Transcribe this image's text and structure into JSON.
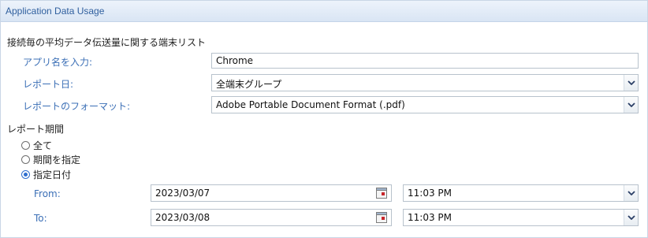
{
  "panel": {
    "title": "Application Data Usage"
  },
  "report": {
    "title": "接続毎の平均データ伝送量に関する端末リスト",
    "app_name_label": "アプリ名を入力:",
    "app_name_value": "Chrome",
    "report_date_label": "レポート日:",
    "report_date_value": "全端末グループ",
    "format_label": "レポートのフォーマット:",
    "format_value": "Adobe Portable Document Format (.pdf)"
  },
  "period": {
    "title": "レポート期間",
    "options": [
      {
        "label": "全て",
        "checked": false
      },
      {
        "label": "期間を指定",
        "checked": false
      },
      {
        "label": "指定日付",
        "checked": true
      }
    ],
    "from_label": "From:",
    "from_date": "2023/03/07",
    "from_time": "11:03 PM",
    "to_label": "To:",
    "to_date": "2023/03/08",
    "to_time": "11:03 PM"
  },
  "icons": {
    "dropdown": "chevron-down-icon",
    "calendar": "calendar-icon"
  },
  "colors": {
    "label_blue": "#3b6fb6",
    "header_gradient_top": "#edf3fb",
    "header_gradient_bottom": "#d9e5f4",
    "radio_selected": "#2f6fcf"
  }
}
